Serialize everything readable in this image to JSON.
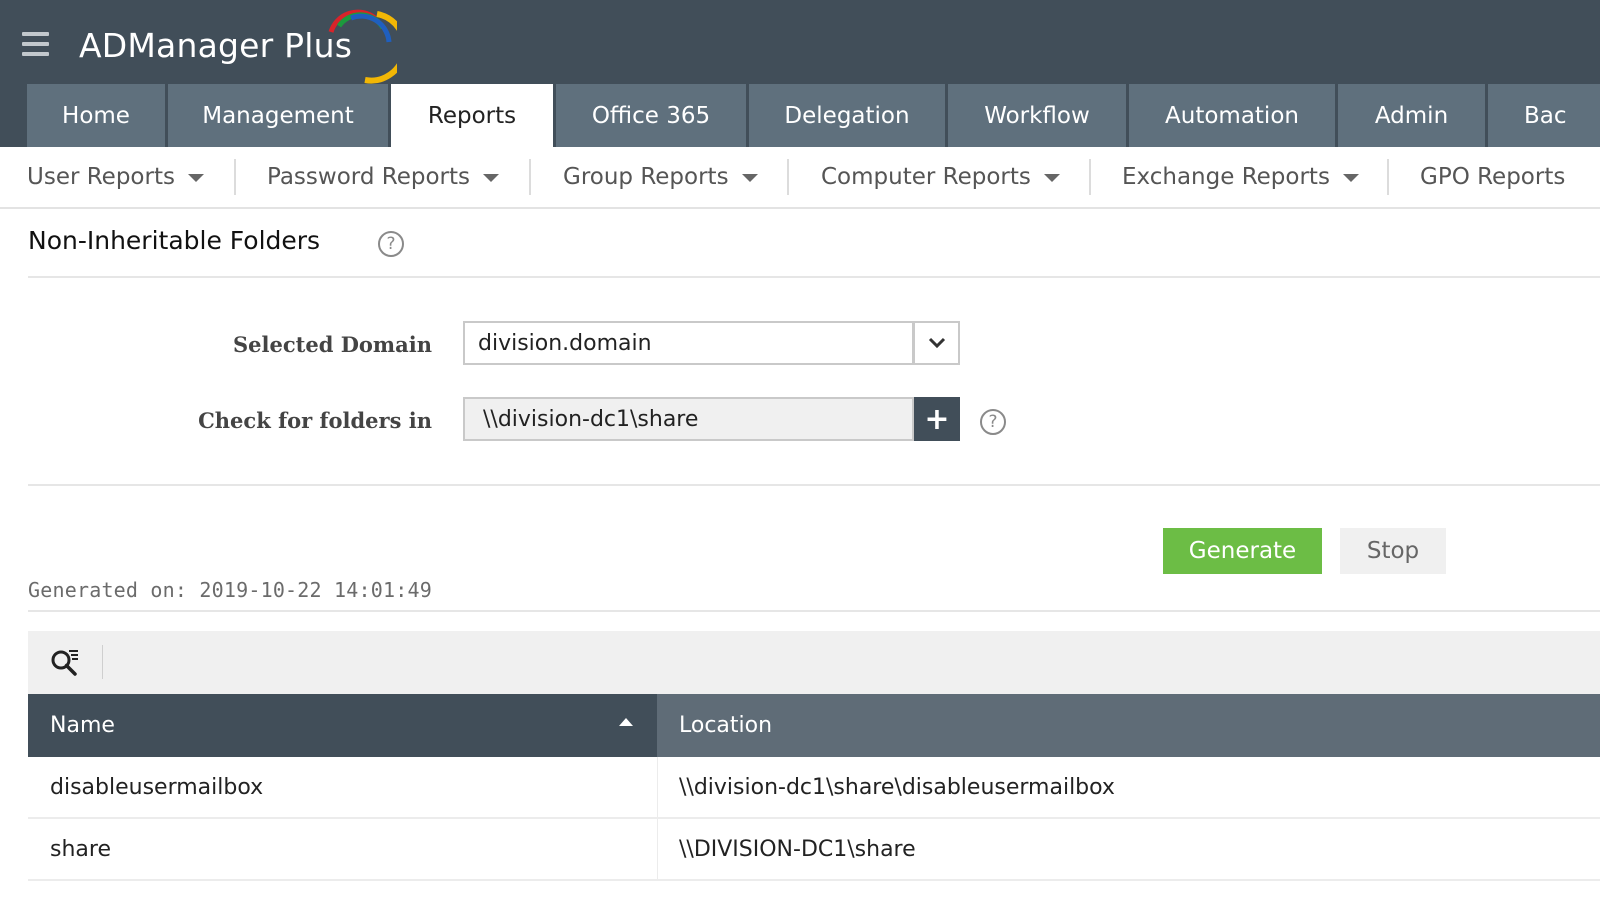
{
  "app": {
    "name": "ADManager Plus"
  },
  "main_tabs": [
    {
      "label": "Home"
    },
    {
      "label": "Management"
    },
    {
      "label": "Reports",
      "active": true
    },
    {
      "label": "Office 365"
    },
    {
      "label": "Delegation"
    },
    {
      "label": "Workflow"
    },
    {
      "label": "Automation"
    },
    {
      "label": "Admin"
    },
    {
      "label": "Bac"
    }
  ],
  "sub_nav": [
    {
      "label": "User Reports",
      "has_dropdown": true
    },
    {
      "label": "Password Reports",
      "has_dropdown": true
    },
    {
      "label": "Group Reports",
      "has_dropdown": true
    },
    {
      "label": "Computer Reports",
      "has_dropdown": true
    },
    {
      "label": "Exchange Reports",
      "has_dropdown": true
    },
    {
      "label": "GPO Reports",
      "has_dropdown": false
    }
  ],
  "page": {
    "title": "Non-Inheritable Folders",
    "help_glyph": "?"
  },
  "form": {
    "domain_label": "Selected Domain",
    "domain_value": "division.domain",
    "folders_label": "Check for folders in",
    "folders_value": "\\\\division-dc1\\share",
    "add_glyph": "+",
    "help_glyph": "?"
  },
  "actions": {
    "generate_label": "Generate",
    "stop_label": "Stop"
  },
  "report": {
    "generated_on": "Generated on: 2019-10-22 14:01:49",
    "columns": [
      "Name",
      "Location"
    ],
    "sorted_column": "Name",
    "sort_direction": "ascending",
    "rows": [
      {
        "name": "disableusermailbox",
        "location": "\\\\division-dc1\\share\\disableusermailbox"
      },
      {
        "name": "share",
        "location": "\\\\DIVISION-DC1\\share"
      }
    ]
  },
  "icons": {
    "menu": "hamburger-menu-icon",
    "search": "search-filter-icon",
    "help": "help-circle-icon",
    "dropdown": "chevron-down-icon",
    "add": "plus-icon",
    "sort": "sort-ascending-icon"
  },
  "colors": {
    "header_bg": "#414e59",
    "tab_bg": "#5f707d",
    "generate_green": "#6cbd45",
    "table_header_dark": "#414e59",
    "table_header_light": "#5f6c77"
  }
}
